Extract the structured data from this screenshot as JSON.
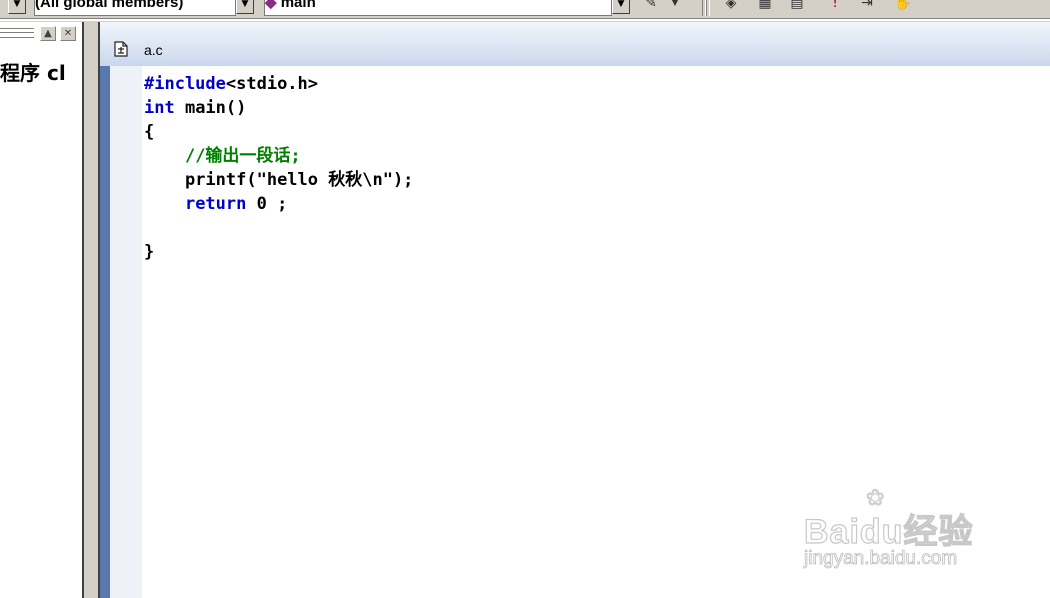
{
  "toolbar": {
    "scope_combo": "(All global members)",
    "function_combo": "main"
  },
  "workspace": {
    "partial_text": "程序 cl"
  },
  "editor": {
    "file_name": "a.c",
    "code": {
      "line1_directive": "#include",
      "line1_rest": "<stdio.h>",
      "line2_type": "int",
      "line2_rest": " main()",
      "line3": "{",
      "line4_comment": "//输出一段话;",
      "line5": "printf(\"hello 秋秋\\n\");",
      "line6_keyword": "return",
      "line6_rest": " 0 ;",
      "line8": "}"
    }
  },
  "watermark": {
    "logo_text": "Baidu经验",
    "url": "jingyan.baidu.com"
  }
}
